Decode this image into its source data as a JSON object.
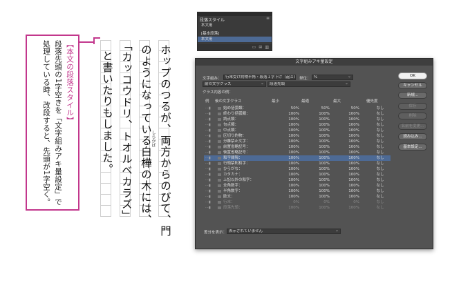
{
  "annotation": {
    "title": "【本文の段落スタイル】",
    "lines": [
      "段落先頭の1字空きを「文字組みアキ量設定」で",
      "処理している時、改段すると、先頭が1字空く。"
    ],
    "color": "#c2378c"
  },
  "manuscript": {
    "columns": [
      "ホップのつるが、両方からのびて、門",
      "のようになっている白樺の木には、",
      "「カッコウドリ、トオルベカラズ」",
      "と書いたりもしました。"
    ],
    "ruby": "しらかば"
  },
  "paragraph_styles_panel": {
    "tab": "段落スタイル",
    "current": "本文用",
    "items": [
      "[基本段落]",
      "本文用"
    ],
    "selected_index": 1
  },
  "dialog": {
    "title": "文字組みアキ量設定",
    "mojikumi_label": "文字組み：",
    "mojikumi_value": "行末受け約物半角・段落１字下げ（起こし全角）",
    "unit_label": "単位：",
    "unit_value": "%",
    "prev_class_value": "前の文字クラス",
    "next_class_value": "段落先頭",
    "section_label": "クラス内容の例：",
    "columns": [
      "例",
      "後の文字クラス",
      "最小",
      "最適",
      "最大",
      "優先度"
    ],
    "rows": [
      {
        "name": "始め括弧類：",
        "min": "50%",
        "opt": "50%",
        "max": "50%",
        "pri": "なし"
      },
      {
        "name": "終わり括弧類：",
        "min": "100%",
        "opt": "100%",
        "max": "100%",
        "pri": "なし"
      },
      {
        "name": "読点類：",
        "min": "100%",
        "opt": "100%",
        "max": "100%",
        "pri": "なし"
      },
      {
        "name": "句点類：",
        "min": "100%",
        "opt": "100%",
        "max": "100%",
        "pri": "なし"
      },
      {
        "name": "中点類：",
        "min": "100%",
        "opt": "100%",
        "max": "100%",
        "pri": "なし"
      },
      {
        "name": "区切り約物：",
        "min": "100%",
        "opt": "100%",
        "max": "100%",
        "pri": "なし"
      },
      {
        "name": "分離禁止文字：",
        "min": "100%",
        "opt": "100%",
        "max": "100%",
        "pri": "なし"
      },
      {
        "name": "前置省略記号：",
        "min": "100%",
        "opt": "100%",
        "max": "100%",
        "pri": "なし"
      },
      {
        "name": "後置省略記号：",
        "min": "100%",
        "opt": "100%",
        "max": "100%",
        "pri": "なし"
      },
      {
        "name": "和字間隔：",
        "min": "100%",
        "opt": "100%",
        "max": "100%",
        "pri": "なし"
      },
      {
        "name": "行頭禁則和字：",
        "min": "100%",
        "opt": "100%",
        "max": "100%",
        "pri": "なし"
      },
      {
        "name": "ひらがな：",
        "min": "100%",
        "opt": "100%",
        "max": "100%",
        "pri": "なし"
      },
      {
        "name": "カタカナ：",
        "min": "100%",
        "opt": "100%",
        "max": "100%",
        "pri": "なし"
      },
      {
        "name": "上記以外の和字：",
        "min": "100%",
        "opt": "100%",
        "max": "100%",
        "pri": "なし"
      },
      {
        "name": "全角数字：",
        "min": "100%",
        "opt": "100%",
        "max": "100%",
        "pri": "なし"
      },
      {
        "name": "半角数字：",
        "min": "100%",
        "opt": "100%",
        "max": "100%",
        "pri": "なし"
      },
      {
        "name": "欧文：",
        "min": "100%",
        "opt": "100%",
        "max": "100%",
        "pri": "なし"
      },
      {
        "name": "行末：",
        "min": "0%",
        "opt": "0%",
        "max": "0%",
        "pri": "なし"
      },
      {
        "name": "段落先頭：",
        "min": "100%",
        "opt": "100%",
        "max": "100%",
        "pri": "なし"
      }
    ],
    "selected_row_index": 9,
    "display_label": "差分を表示：",
    "display_value": "表示されていません",
    "buttons": {
      "ok": "OK",
      "cancel": "キャンセル",
      "new": "新規...",
      "save": "保存",
      "delete": "削除",
      "rename": "名前を変更...",
      "import": "読み込み...",
      "basic": "基本設定..."
    }
  }
}
